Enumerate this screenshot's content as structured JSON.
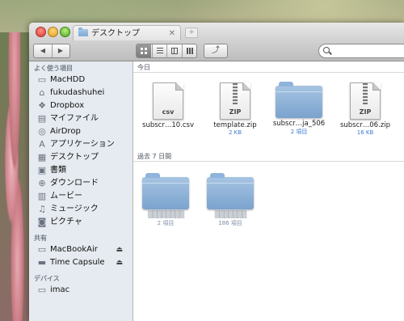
{
  "window": {
    "tab_title": "デスクトップ",
    "tab_close": "✕",
    "new_tab": "+"
  },
  "toolbar": {
    "back": "◀",
    "forward": "▶",
    "share": "⤴",
    "search": {
      "value": "",
      "placeholder": ""
    }
  },
  "sidebar": {
    "sections": [
      {
        "header": "よく使う項目",
        "items": [
          {
            "label": "MacHDD",
            "icon": "drive-icon"
          },
          {
            "label": "fukudashuhei",
            "icon": "home-icon"
          },
          {
            "label": "Dropbox",
            "icon": "dropbox-icon"
          },
          {
            "label": "マイファイル",
            "icon": "all-files-icon"
          },
          {
            "label": "AirDrop",
            "icon": "airdrop-icon"
          },
          {
            "label": "アプリケーション",
            "icon": "applications-icon"
          },
          {
            "label": "デスクトップ",
            "icon": "desktop-icon"
          },
          {
            "label": "書類",
            "icon": "documents-icon"
          },
          {
            "label": "ダウンロード",
            "icon": "downloads-icon"
          },
          {
            "label": "ムービー",
            "icon": "movies-icon"
          },
          {
            "label": "ミュージック",
            "icon": "music-icon"
          },
          {
            "label": "ピクチャ",
            "icon": "pictures-icon"
          }
        ]
      },
      {
        "header": "共有",
        "items": [
          {
            "label": "MacBookAir",
            "icon": "computer-icon",
            "eject": "⏏"
          },
          {
            "label": "Time Capsule",
            "icon": "time-capsule-icon",
            "eject": "⏏"
          }
        ]
      },
      {
        "header": "デバイス",
        "items": [
          {
            "label": "imac",
            "icon": "imac-icon"
          }
        ]
      }
    ]
  },
  "content": {
    "sections": [
      {
        "header": "今日",
        "files": [
          {
            "name": "subscr…10.csv",
            "sub": "",
            "kind": "document",
            "ext": "csv"
          },
          {
            "name": "template.zip",
            "sub": "2 KB",
            "kind": "zip",
            "ext": "ZIP"
          },
          {
            "name": "subscr…ja_506",
            "sub": "2 項目",
            "kind": "folder"
          },
          {
            "name": "subscr…06.zip",
            "sub": "16 KB",
            "kind": "zip",
            "ext": "ZIP"
          }
        ]
      },
      {
        "header": "過去 7 日間",
        "files": [
          {
            "name": "",
            "sub": "2 項目",
            "kind": "folder"
          },
          {
            "name": "",
            "sub": "186 項目",
            "kind": "folder"
          }
        ]
      }
    ]
  },
  "colors": {
    "sidebar_bg": "#e6ebf1",
    "folder_blue": "#7aa3ce",
    "size_text": "#3d7bd2"
  }
}
